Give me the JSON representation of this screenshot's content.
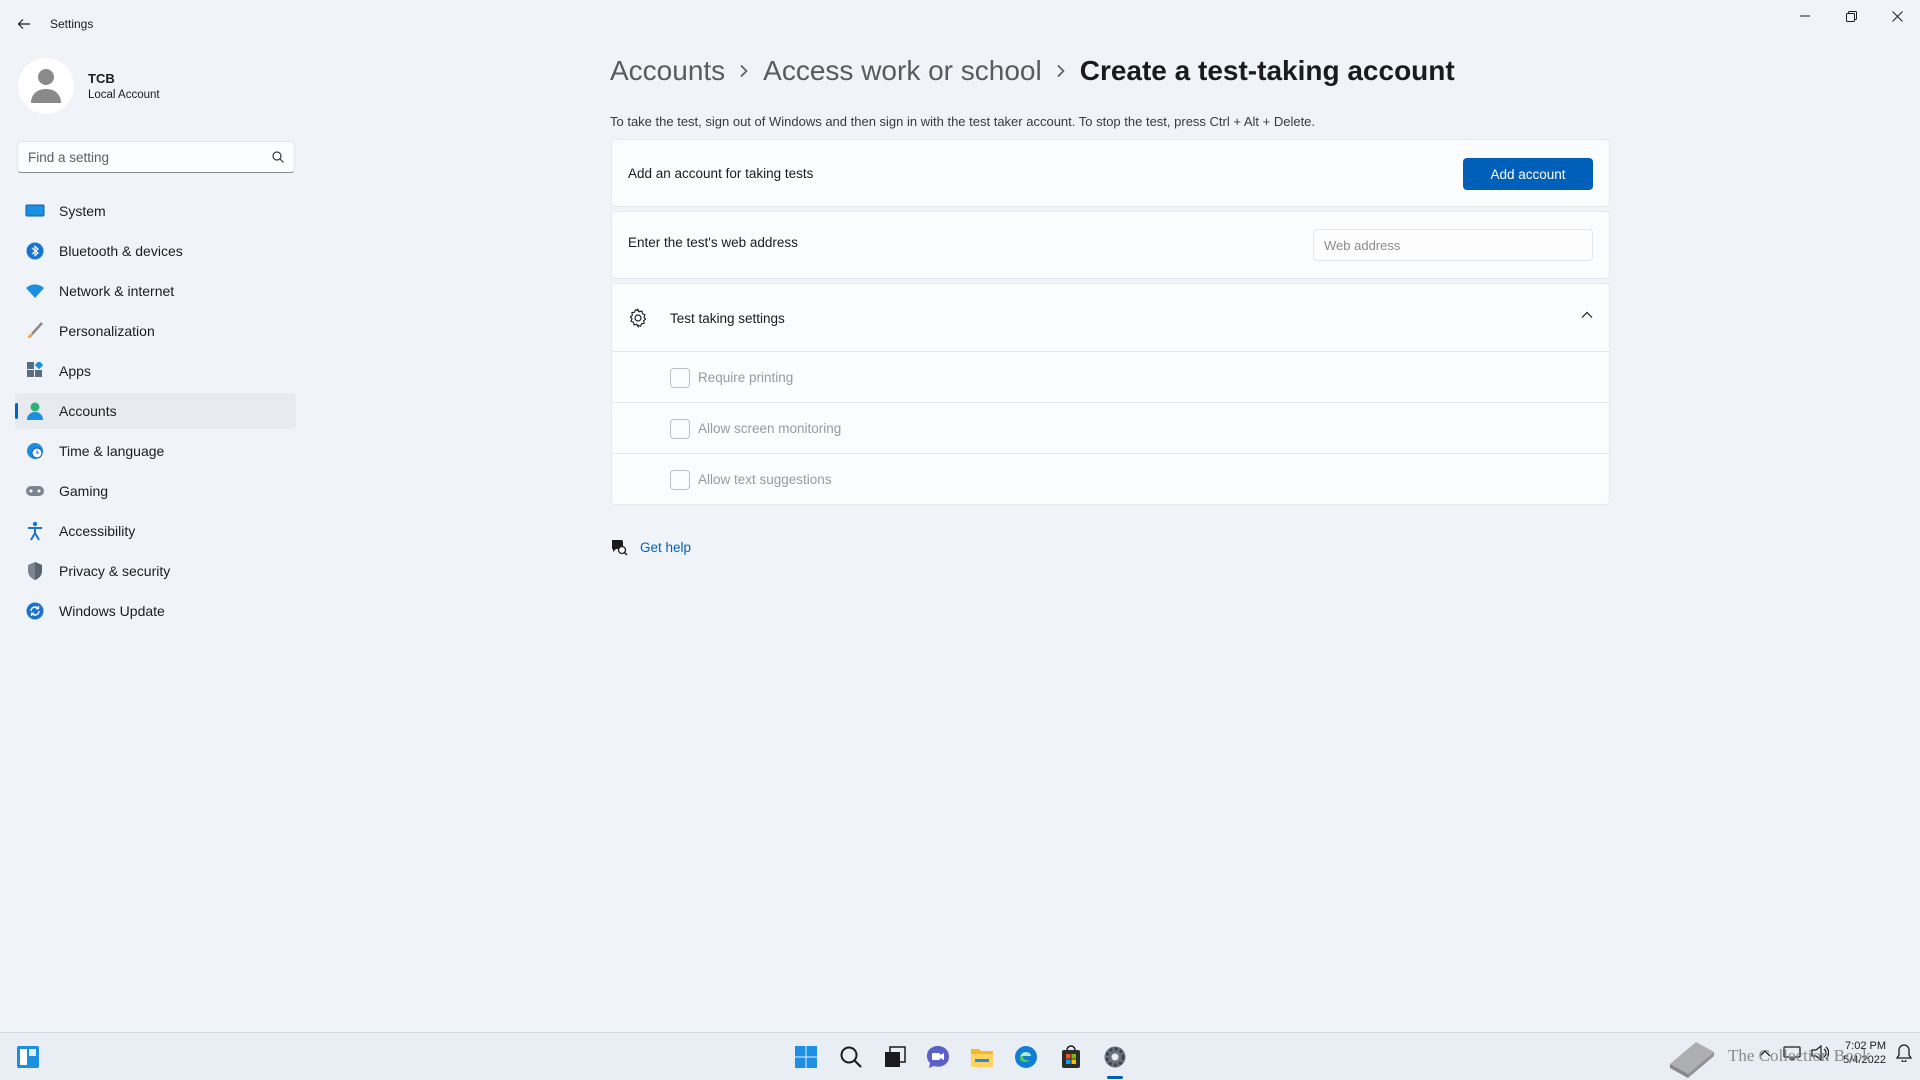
{
  "window": {
    "title": "Settings",
    "controls": [
      "minimize",
      "restore",
      "close"
    ]
  },
  "profile": {
    "name": "TCB",
    "account_type": "Local Account"
  },
  "search": {
    "placeholder": "Find a setting"
  },
  "nav": {
    "items": [
      {
        "label": "System",
        "icon": "system-icon"
      },
      {
        "label": "Bluetooth & devices",
        "icon": "bluetooth-icon"
      },
      {
        "label": "Network & internet",
        "icon": "wifi-icon"
      },
      {
        "label": "Personalization",
        "icon": "brush-icon"
      },
      {
        "label": "Apps",
        "icon": "apps-icon"
      },
      {
        "label": "Accounts",
        "icon": "person-icon",
        "active": true
      },
      {
        "label": "Time & language",
        "icon": "globe-clock-icon"
      },
      {
        "label": "Gaming",
        "icon": "gamepad-icon"
      },
      {
        "label": "Accessibility",
        "icon": "accessibility-icon"
      },
      {
        "label": "Privacy & security",
        "icon": "shield-icon"
      },
      {
        "label": "Windows Update",
        "icon": "update-icon"
      }
    ]
  },
  "breadcrumb": {
    "items": [
      "Accounts",
      "Access work or school"
    ],
    "current": "Create a test-taking account"
  },
  "description": "To take the test, sign out of Windows and then sign in with the test taker account. To stop the test, press Ctrl + Alt + Delete.",
  "add_account_card": {
    "label": "Add an account for taking tests",
    "button": "Add account"
  },
  "web_address_card": {
    "label": "Enter the test's web address",
    "placeholder": "Web address"
  },
  "test_settings": {
    "title": "Test taking settings",
    "options": [
      {
        "label": "Require printing",
        "checked": false
      },
      {
        "label": "Allow screen monitoring",
        "checked": false
      },
      {
        "label": "Allow text suggestions",
        "checked": false
      }
    ]
  },
  "help": {
    "label": "Get help"
  },
  "taskbar": {
    "apps": [
      "start-icon",
      "search-icon",
      "task-view-icon",
      "chat-icon",
      "file-explorer-icon",
      "edge-icon",
      "store-icon",
      "settings-icon"
    ],
    "active_app": "settings-icon",
    "time": "7:02 PM",
    "date": "5/4/2022"
  },
  "watermark": {
    "text": "The Collection Book"
  },
  "colors": {
    "accent": "#005fb8",
    "background": "#f0f4f9",
    "card": "#fbfcfd"
  }
}
